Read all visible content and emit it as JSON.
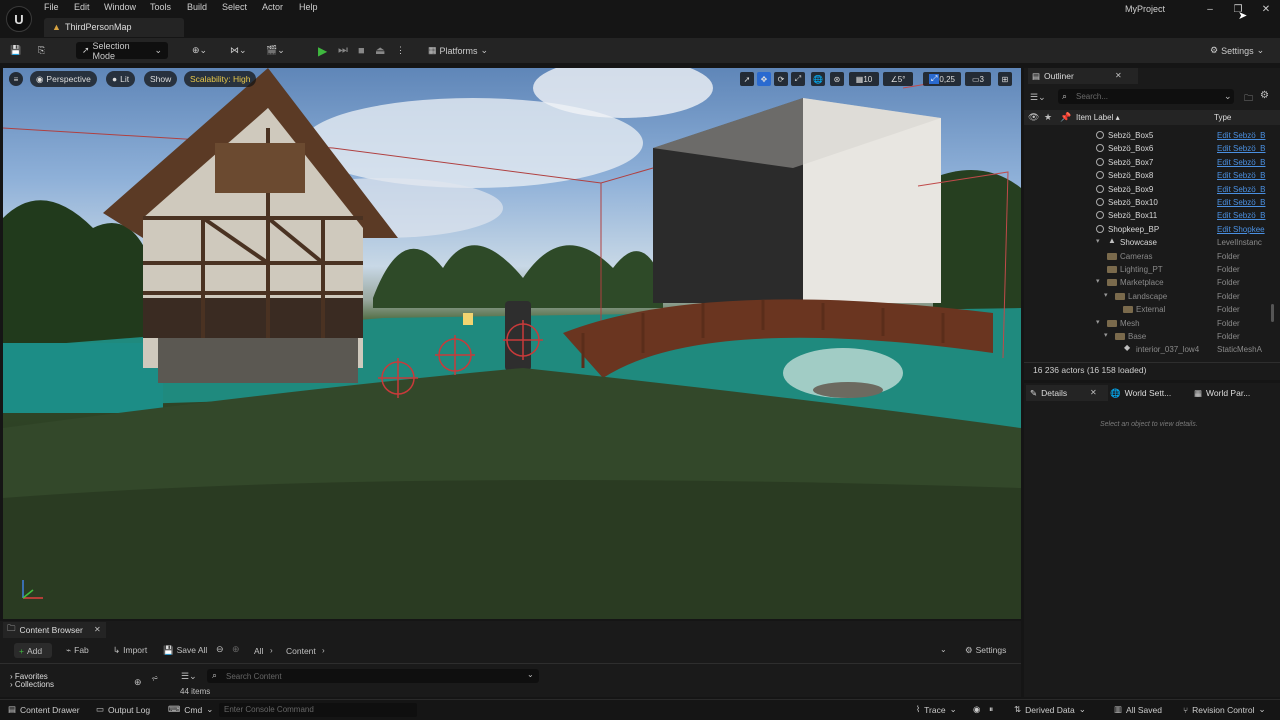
{
  "app": {
    "logo": "U",
    "project_name": "MyProject",
    "map_tab": "ThirdPersonMap"
  },
  "menu": [
    "File",
    "Edit",
    "Window",
    "Tools",
    "Build",
    "Select",
    "Actor",
    "Help"
  ],
  "toolbar": {
    "selection_mode": "Selection Mode",
    "platforms": "Platforms",
    "settings": "Settings"
  },
  "viewport": {
    "perspective": "Perspective",
    "lit": "Lit",
    "show": "Show",
    "scalability": "Scalability: High",
    "grid_value": "10",
    "rotation_value": "5°",
    "scale_value": "0,25",
    "camera_speed": "3"
  },
  "outliner": {
    "tab": "Outliner",
    "search_placeholder": "Search...",
    "col_label": "Item Label ▴",
    "col_type": "Type",
    "rows": [
      {
        "label": "Sebzö_Box5",
        "type": "Edit Sebzö_B",
        "kind": "actor",
        "indent": 0
      },
      {
        "label": "Sebzö_Box6",
        "type": "Edit Sebzö_B",
        "kind": "actor",
        "indent": 0
      },
      {
        "label": "Sebzö_Box7",
        "type": "Edit Sebzö_B",
        "kind": "actor",
        "indent": 0
      },
      {
        "label": "Sebzö_Box8",
        "type": "Edit Sebzö_B",
        "kind": "actor",
        "indent": 0
      },
      {
        "label": "Sebzö_Box9",
        "type": "Edit Sebzö_B",
        "kind": "actor",
        "indent": 0
      },
      {
        "label": "Sebzö_Box10",
        "type": "Edit Sebzö_B",
        "kind": "actor",
        "indent": 0
      },
      {
        "label": "Sebzö_Box11",
        "type": "Edit Sebzö_B",
        "kind": "actor",
        "indent": 0
      },
      {
        "label": "Shopkeep_BP",
        "type": "Edit Shopkee",
        "kind": "actor",
        "indent": 0
      },
      {
        "label": "Showcase",
        "type": "LevelInstanc",
        "kind": "level",
        "indent": 0
      },
      {
        "label": "Cameras",
        "type": "Folder",
        "kind": "folder",
        "indent": 1
      },
      {
        "label": "Lighting_PT",
        "type": "Folder",
        "kind": "folder",
        "indent": 1
      },
      {
        "label": "Marketplace",
        "type": "Folder",
        "kind": "folder-open",
        "indent": 1
      },
      {
        "label": "Landscape",
        "type": "Folder",
        "kind": "folder-open",
        "indent": 2
      },
      {
        "label": "External",
        "type": "Folder",
        "kind": "folder",
        "indent": 3
      },
      {
        "label": "Mesh",
        "type": "Folder",
        "kind": "folder-open",
        "indent": 1
      },
      {
        "label": "Base",
        "type": "Folder",
        "kind": "folder-open",
        "indent": 2
      },
      {
        "label": "interior_037_low4",
        "type": "StaticMeshA",
        "kind": "mesh",
        "indent": 3
      }
    ],
    "actor_count": "16 236 actors (16 158 loaded)"
  },
  "details": {
    "tab": "Details",
    "tab2": "World Sett...",
    "tab3": "World Par...",
    "empty_text": "Select an object to view details."
  },
  "content_browser": {
    "tab": "Content Browser",
    "add": "Add",
    "fab": "Fab",
    "import": "Import",
    "save_all": "Save All",
    "path_all": "All",
    "path_content": "Content",
    "settings": "Settings",
    "favorites": "Favorites",
    "collections": "Collections",
    "search_placeholder": "Search Content",
    "item_count": "44 items"
  },
  "status": {
    "content_drawer": "Content Drawer",
    "output_log": "Output Log",
    "cmd": "Cmd",
    "console_placeholder": "Enter Console Command",
    "trace": "Trace",
    "derived_data": "Derived Data",
    "all_saved": "All Saved",
    "revision_control": "Revision Control"
  },
  "colors": {
    "link": "#4a90e2",
    "scalability": "#e8c84a",
    "play": "#3fb83f"
  }
}
